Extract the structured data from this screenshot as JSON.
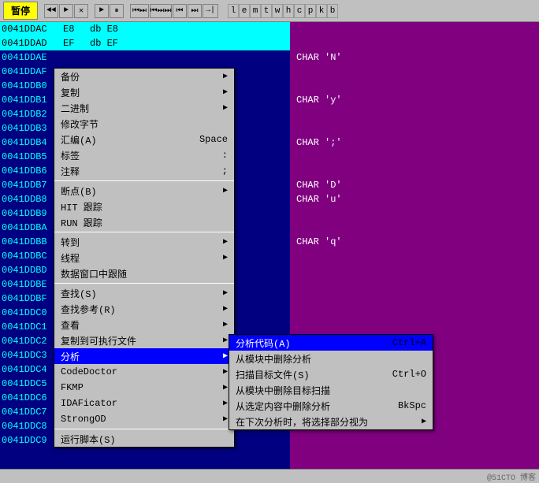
{
  "toolbar": {
    "pause_label": "暂停",
    "buttons": [
      "◄◄",
      "►",
      "✕",
      "►",
      "⏸",
      "⏮⏭",
      "⏮⏭⏭",
      "⏮",
      "⏭",
      "→|"
    ],
    "letters": [
      "l",
      "e",
      "m",
      "t",
      "w",
      "h",
      "c",
      "p",
      "k",
      "b"
    ]
  },
  "code_rows": [
    {
      "addr": "0041DDAC",
      "opcode": "E8",
      "instruction": "db E8",
      "highlight": true
    },
    {
      "addr": "0041DDAD",
      "opcode": "EF",
      "instruction": "db EF",
      "highlight": true
    },
    {
      "addr": "0041DDAE",
      "opcode": "",
      "instruction": "",
      "highlight": false
    },
    {
      "addr": "0041DDAF",
      "opcode": "",
      "instruction": "",
      "highlight": false
    },
    {
      "addr": "0041DDB0",
      "opcode": "",
      "instruction": "",
      "highlight": false
    },
    {
      "addr": "0041DDB1",
      "opcode": "",
      "instruction": "",
      "highlight": false
    },
    {
      "addr": "0041DDB2",
      "opcode": "",
      "instruction": "",
      "highlight": false
    },
    {
      "addr": "0041DDB3",
      "opcode": "",
      "instruction": "",
      "highlight": false
    },
    {
      "addr": "0041DDB4",
      "opcode": "",
      "instruction": "",
      "highlight": false
    },
    {
      "addr": "0041DDB5",
      "opcode": "",
      "instruction": "",
      "highlight": false
    },
    {
      "addr": "0041DDB6",
      "opcode": "",
      "instruction": "",
      "highlight": false
    },
    {
      "addr": "0041DDB7",
      "opcode": "",
      "instruction": "",
      "highlight": false
    },
    {
      "addr": "0041DDB8",
      "opcode": "",
      "instruction": "",
      "highlight": false
    },
    {
      "addr": "0041DDB9",
      "opcode": "",
      "instruction": "",
      "highlight": false
    },
    {
      "addr": "0041DDBA",
      "opcode": "",
      "instruction": "",
      "highlight": false
    },
    {
      "addr": "0041DDBB",
      "opcode": "",
      "instruction": "",
      "highlight": false
    },
    {
      "addr": "0041DDBC",
      "opcode": "",
      "instruction": "",
      "highlight": false
    },
    {
      "addr": "0041DDBD",
      "opcode": "",
      "instruction": "",
      "highlight": false
    },
    {
      "addr": "0041DDBE",
      "opcode": "",
      "instruction": "",
      "highlight": false
    },
    {
      "addr": "0041DDBF",
      "opcode": "",
      "instruction": "",
      "highlight": false
    },
    {
      "addr": "0041DDC0",
      "opcode": "",
      "instruction": "",
      "highlight": false
    },
    {
      "addr": "0041DDC1",
      "opcode": "",
      "instruction": "",
      "highlight": false
    },
    {
      "addr": "0041DDC2",
      "opcode": "",
      "instruction": "",
      "highlight": false,
      "selected": true
    },
    {
      "addr": "0041DDC3",
      "opcode": "",
      "instruction": "",
      "highlight": false
    },
    {
      "addr": "0041DDC4",
      "opcode": "",
      "instruction": "",
      "highlight": false
    },
    {
      "addr": "0041DDC5",
      "opcode": "",
      "instruction": "",
      "highlight": false
    },
    {
      "addr": "0041DDC6",
      "opcode": "",
      "instruction": "",
      "highlight": false
    },
    {
      "addr": "0041DDC7",
      "opcode": "",
      "instruction": "",
      "highlight": false
    },
    {
      "addr": "0041DDC8",
      "opcode": "",
      "instruction": "",
      "highlight": false
    },
    {
      "addr": "0041DDC9",
      "opcode": "",
      "instruction": "",
      "highlight": false
    }
  ],
  "right_chars": [
    {
      "row": 0,
      "val": ""
    },
    {
      "row": 1,
      "val": ""
    },
    {
      "row": 2,
      "val": "CHAR 'N'"
    },
    {
      "row": 3,
      "val": ""
    },
    {
      "row": 4,
      "val": ""
    },
    {
      "row": 5,
      "val": "CHAR 'y'"
    },
    {
      "row": 6,
      "val": ""
    },
    {
      "row": 7,
      "val": ""
    },
    {
      "row": 8,
      "val": "CHAR ';'"
    },
    {
      "row": 9,
      "val": ""
    },
    {
      "row": 10,
      "val": ""
    },
    {
      "row": 11,
      "val": "CHAR 'D'"
    },
    {
      "row": 12,
      "val": "CHAR 'u'"
    },
    {
      "row": 13,
      "val": ""
    },
    {
      "row": 14,
      "val": ""
    },
    {
      "row": 15,
      "val": "CHAR 'q'"
    },
    {
      "row": 16,
      "val": ""
    },
    {
      "row": 17,
      "val": ""
    },
    {
      "row": 18,
      "val": ""
    },
    {
      "row": 19,
      "val": ""
    },
    {
      "row": 20,
      "val": ""
    },
    {
      "row": 21,
      "val": ""
    },
    {
      "row": 22,
      "val": ""
    }
  ],
  "menu1": {
    "items": [
      {
        "label": "备份",
        "shortcut": "",
        "has_arrow": true,
        "sep_after": false
      },
      {
        "label": "复制",
        "shortcut": "",
        "has_arrow": true,
        "sep_after": false
      },
      {
        "label": "二进制",
        "shortcut": "",
        "has_arrow": true,
        "sep_after": false
      },
      {
        "label": "修改字节",
        "shortcut": "",
        "has_arrow": false,
        "sep_after": false
      },
      {
        "label": "汇编(A)",
        "shortcut": "Space",
        "has_arrow": false,
        "sep_after": false
      },
      {
        "label": "标签",
        "shortcut": ":",
        "has_arrow": false,
        "sep_after": false
      },
      {
        "label": "注释",
        "shortcut": ";",
        "has_arrow": false,
        "sep_after": true
      },
      {
        "label": "断点(B)",
        "shortcut": "",
        "has_arrow": true,
        "sep_after": false
      },
      {
        "label": "HIT 跟踪",
        "shortcut": "",
        "has_arrow": false,
        "sep_after": false
      },
      {
        "label": "RUN 跟踪",
        "shortcut": "",
        "has_arrow": false,
        "sep_after": true
      },
      {
        "label": "转到",
        "shortcut": "",
        "has_arrow": true,
        "sep_after": false
      },
      {
        "label": "线程",
        "shortcut": "",
        "has_arrow": true,
        "sep_after": false
      },
      {
        "label": "数据窗口中跟随",
        "shortcut": "",
        "has_arrow": false,
        "sep_after": true
      },
      {
        "label": "查找(S)",
        "shortcut": "",
        "has_arrow": true,
        "sep_after": false
      },
      {
        "label": "查找参考(R)",
        "shortcut": "",
        "has_arrow": true,
        "sep_after": false
      },
      {
        "label": "查看",
        "shortcut": "",
        "has_arrow": true,
        "sep_after": false
      },
      {
        "label": "复制到可执行文件",
        "shortcut": "",
        "has_arrow": true,
        "sep_after": false
      },
      {
        "label": "分析",
        "shortcut": "",
        "has_arrow": true,
        "sep_after": false,
        "active": true
      },
      {
        "label": "CodeDoctor",
        "shortcut": "",
        "has_arrow": true,
        "sep_after": false
      },
      {
        "label": "FKMP",
        "shortcut": "",
        "has_arrow": true,
        "sep_after": false
      },
      {
        "label": "IDAFicator",
        "shortcut": "",
        "has_arrow": true,
        "sep_after": false
      },
      {
        "label": "StrongOD",
        "shortcut": "",
        "has_arrow": true,
        "sep_after": true
      },
      {
        "label": "运行脚本(S)",
        "shortcut": "",
        "has_arrow": false,
        "sep_after": false
      }
    ]
  },
  "menu2": {
    "items": [
      {
        "label": "分析代码(A)",
        "shortcut": "Ctrl+A",
        "has_arrow": false,
        "active": true
      },
      {
        "label": "从模块中删除分析",
        "shortcut": "",
        "has_arrow": false
      },
      {
        "label": "扫描目标文件(S)",
        "shortcut": "Ctrl+O",
        "has_arrow": false
      },
      {
        "label": "从模块中删除目标扫描",
        "shortcut": "",
        "has_arrow": false
      },
      {
        "label": "从选定内容中删除分析",
        "shortcut": "BkSpc",
        "has_arrow": false
      },
      {
        "label": "在下次分析时，将选择部分视为",
        "shortcut": "",
        "has_arrow": true
      }
    ]
  },
  "watermark": "@51CTO 博客"
}
